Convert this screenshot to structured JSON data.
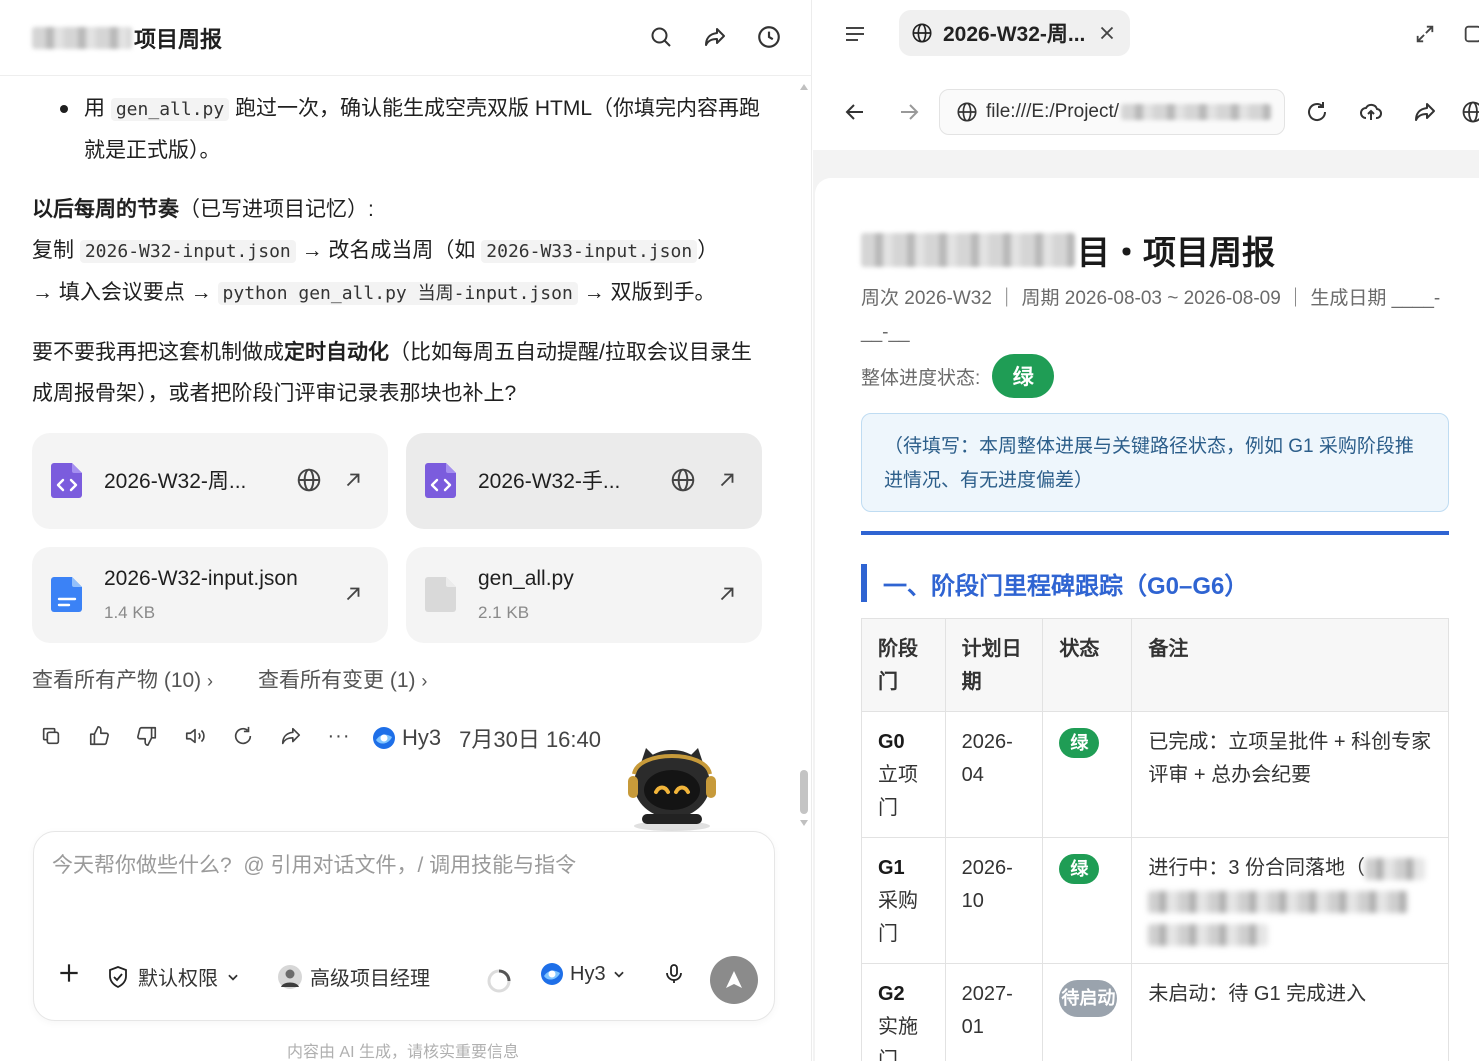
{
  "chat": {
    "title_suffix": "项目周报",
    "bullet": {
      "pre": "用",
      "code": "gen_all.py",
      "post": "跑过一次，确认能生成空壳双版 HTML（你填完内容再跑就是正式版）。"
    },
    "rhythm": {
      "bold": "以后每周的节奏",
      "rest": "（已写进项目记忆）:",
      "line1_pre": "复制",
      "line1_code1": "2026-W32-input.json",
      "line1_mid": "→ 改名成当周（如",
      "line1_code2": "2026-W33-input.json",
      "line1_end": "）",
      "line2_pre": "→ 填入会议要点 →",
      "line2_code": "python gen_all.py 当周-input.json",
      "line2_end": "→ 双版到手。"
    },
    "question": {
      "pre": "要不要我再把这套机制做成",
      "bold": "定时自动化",
      "post": "（比如每周五自动提醒/拉取会议目录生成周报骨架），或者把阶段门评审记录表那块也补上?"
    },
    "cards": [
      {
        "name": "2026-W32-周...",
        "size": ""
      },
      {
        "name": "2026-W32-手...",
        "size": ""
      },
      {
        "name": "2026-W32-input.json",
        "size": "1.4 KB"
      },
      {
        "name": "gen_all.py",
        "size": "2.1 KB"
      }
    ],
    "view_artifacts": "查看所有产物 (10)",
    "view_changes": "查看所有变更 (1)",
    "model": "Hy3",
    "timestamp": "7月30日 16:40"
  },
  "composer": {
    "placeholder": "今天帮你做些什么?  @ 引用对话文件，/ 调用技能与指令",
    "permission": "默认权限",
    "agent": "高级项目经理",
    "model": "Hy3"
  },
  "disclaimer": "内容由 AI 生成，请核实重要信息",
  "browser": {
    "tab_title": "2026-W32-周...",
    "url": "file:///E:/Project/"
  },
  "report": {
    "title_suffix": "目・项目周报",
    "meta": "周次 2026-W32 ｜ 周期 2026-08-03 ~ 2026-08-09 ｜ 生成日期 ____-__-__",
    "status_label": "整体进度状态:",
    "status_value": "绿",
    "summary": "（待填写：本周整体进展与关键路径状态，例如 G1 采购阶段推进情况、有无进度偏差）",
    "section_title": "一、阶段门里程碑跟踪（G0–G6）",
    "table": {
      "headers": [
        "阶段门",
        "计划日期",
        "状态",
        "备注"
      ],
      "rows": [
        {
          "code": "G0",
          "name": "立项门",
          "date": "2026-04",
          "status": "绿",
          "note": "已完成：立项呈批件 + 科创专家评审 + 总办会纪要"
        },
        {
          "code": "G1",
          "name": "采购门",
          "date": "2026-10",
          "status": "绿",
          "note": "进行中：3 份合同落地（"
        },
        {
          "code": "G2",
          "name": "实施门",
          "date": "2027-01",
          "status": "待启动",
          "note": "未启动：待 G1 完成进入"
        }
      ]
    }
  },
  "colors": {
    "accent_blue": "#2f64d2",
    "status_green": "#1f9d55",
    "status_gray": "#9aa3ad",
    "send_button": "#8b8b8b"
  }
}
